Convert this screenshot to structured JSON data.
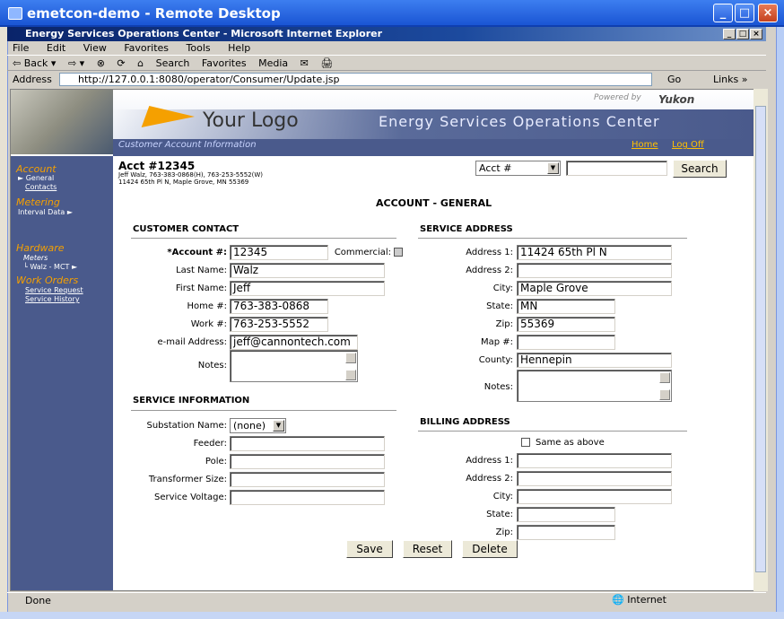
{
  "rd": {
    "title": "emetcon-demo - Remote Desktop"
  },
  "ie": {
    "title": "Energy Services Operations Center - Microsoft Internet Explorer",
    "menu": [
      "File",
      "Edit",
      "View",
      "Favorites",
      "Tools",
      "Help"
    ],
    "toolbar": [
      "⇦ Back ▾",
      "⇨ ▾",
      "⊗",
      "⟳",
      "⌂",
      "Search",
      "Favorites",
      "Media",
      "✉",
      "🖨"
    ],
    "address_label": "Address",
    "address": "http://127.0.0.1:8080/operator/Consumer/Update.jsp",
    "go": "Go",
    "links": "Links »",
    "status": "Done",
    "zone": "Internet"
  },
  "banner": {
    "logo_text": "Your Logo",
    "app_title": "Energy Services Operations Center",
    "powered_by": "Powered by",
    "brand": "Yukon",
    "section": "Customer Account Information",
    "home": "Home",
    "logoff": "Log Off"
  },
  "sidebar": {
    "account": "Account",
    "general": "► General",
    "contacts": "Contacts",
    "metering": "Metering",
    "interval": "Interval Data    ►",
    "hardware": "Hardware",
    "meters": "Meters",
    "walz": "└ Walz - MCT   ►",
    "work_orders": "Work Orders",
    "service_request": "Service Request",
    "service_history": "Service History"
  },
  "account": {
    "number_title": "Acct #12345",
    "line1": "Jeff Walz, 763-383-0868(H), 763-253-5552(W)",
    "line2": "11424 65th Pl N, Maple Grove, MN 55369",
    "heading": "ACCOUNT - GENERAL"
  },
  "search": {
    "type": "Acct #",
    "value": "",
    "button": "Search"
  },
  "contact": {
    "heading": "CUSTOMER CONTACT",
    "account_label": "*Account #:",
    "account": "12345",
    "commercial_label": "Commercial:",
    "last_label": "Last Name:",
    "last": "Walz",
    "first_label": "First Name:",
    "first": "Jeff",
    "home_label": "Home #:",
    "home": "763-383-0868",
    "work_label": "Work #:",
    "work": "763-253-5552",
    "email_label": "e-mail Address:",
    "email": "jeff@cannontech.com",
    "notes_label": "Notes:"
  },
  "service_info": {
    "heading": "SERVICE INFORMATION",
    "substation_label": "Substation Name:",
    "substation": "(none)",
    "feeder_label": "Feeder:",
    "pole_label": "Pole:",
    "transformer_label": "Transformer Size:",
    "voltage_label": "Service Voltage:"
  },
  "service_addr": {
    "heading": "SERVICE ADDRESS",
    "addr1_label": "Address 1:",
    "addr1": "11424 65th Pl N",
    "addr2_label": "Address 2:",
    "city_label": "City:",
    "city": "Maple Grove",
    "state_label": "State:",
    "state": "MN",
    "zip_label": "Zip:",
    "zip": "55369",
    "map_label": "Map #:",
    "county_label": "County:",
    "county": "Hennepin",
    "notes_label": "Notes:"
  },
  "billing": {
    "heading": "BILLING ADDRESS",
    "same_label": "Same as above",
    "addr1_label": "Address 1:",
    "addr2_label": "Address 2:",
    "city_label": "City:",
    "state_label": "State:",
    "zip_label": "Zip:"
  },
  "actions": {
    "save": "Save",
    "reset": "Reset",
    "delete": "Delete"
  }
}
